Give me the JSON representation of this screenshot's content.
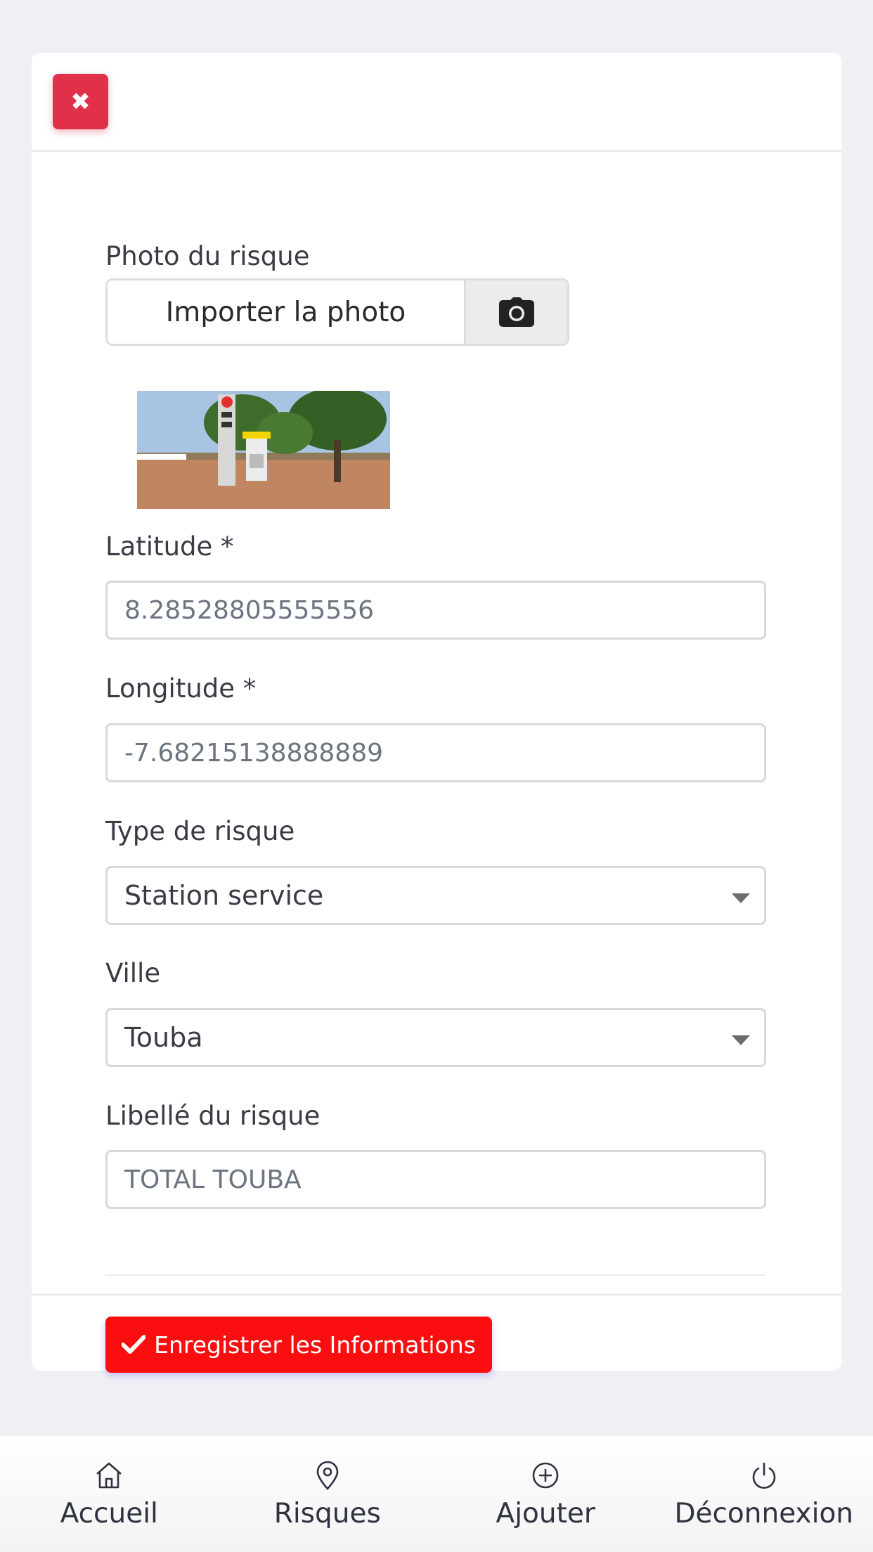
{
  "form": {
    "photo_label": "Photo du risque",
    "upload_text": "Importer la photo",
    "latitude_label": "Latitude *",
    "latitude_value": "8.28528805555556",
    "longitude_label": "Longitude *",
    "longitude_value": "-7.68215138888889",
    "type_label": "Type de risque",
    "type_value": "Station service",
    "ville_label": "Ville",
    "ville_value": "Touba",
    "libelle_label": "Libellé du risque",
    "libelle_value": "TOTAL TOUBA",
    "save_label": "Enregistrer les Informations"
  },
  "nav": {
    "items": [
      {
        "label": "Accueil",
        "icon": "home-icon"
      },
      {
        "label": "Risques",
        "icon": "map-pin-icon"
      },
      {
        "label": "Ajouter",
        "icon": "plus-circle-icon"
      },
      {
        "label": "Déconnexion",
        "icon": "power-icon"
      }
    ]
  },
  "colors": {
    "close": "#e0304a",
    "save": "#fb0e10",
    "background": "#eef0f4"
  }
}
